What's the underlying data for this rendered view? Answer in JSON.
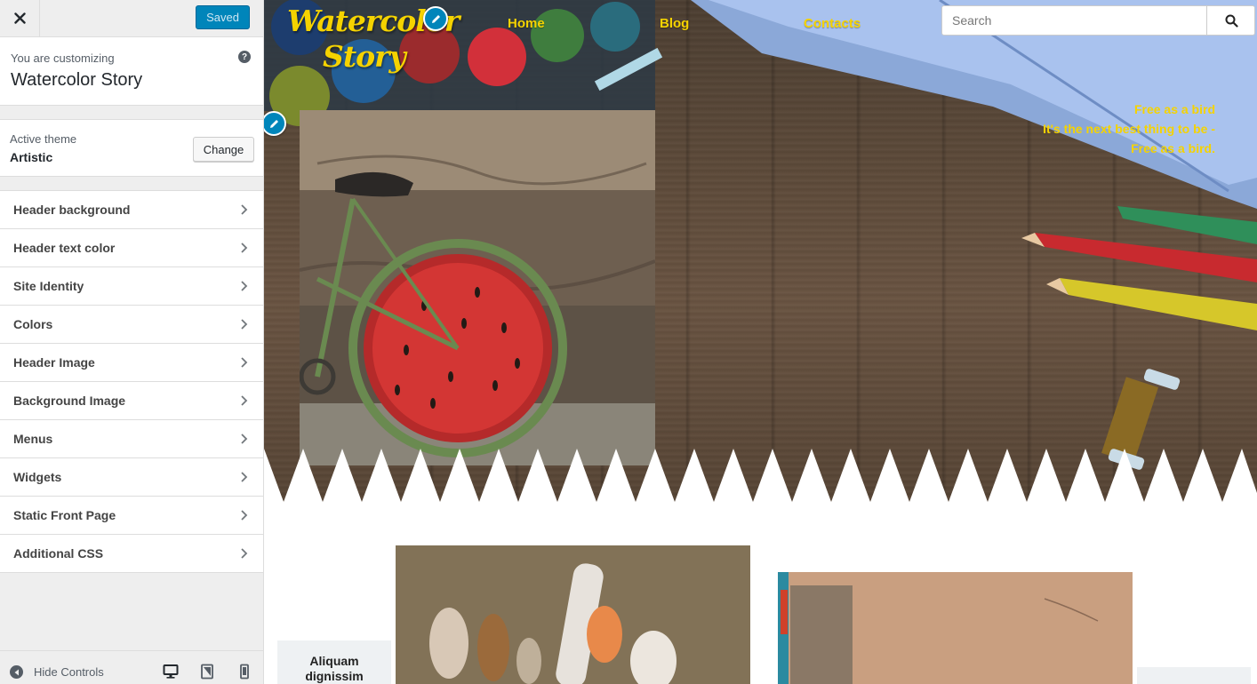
{
  "sidebar": {
    "saved_label": "Saved",
    "customizing_pre": "You are customizing",
    "customizing_title": "Watercolor Story",
    "help_icon": "?",
    "active_theme_label": "Active theme",
    "active_theme_name": "Artistic",
    "change_label": "Change",
    "sections": [
      {
        "label": "Header background"
      },
      {
        "label": "Header text color"
      },
      {
        "label": "Site Identity"
      },
      {
        "label": "Colors"
      },
      {
        "label": "Header Image"
      },
      {
        "label": "Background Image"
      },
      {
        "label": "Menus"
      },
      {
        "label": "Widgets"
      },
      {
        "label": "Static Front Page"
      },
      {
        "label": "Additional CSS"
      }
    ],
    "hide_controls_label": "Hide Controls",
    "accent_color": "#0085ba"
  },
  "preview": {
    "site_title_line1": "Watercolor",
    "site_title_line2": "Story",
    "nav": [
      {
        "label": "Home"
      },
      {
        "label": "Blog"
      },
      {
        "label": "Contacts"
      }
    ],
    "search_placeholder": "Search",
    "tagline": [
      "Free as a bird",
      "It's the next best thing to be -",
      "Free as a bird."
    ],
    "post_label": [
      "Aliquam",
      "dignissim"
    ],
    "title_color": "#f5d300"
  }
}
